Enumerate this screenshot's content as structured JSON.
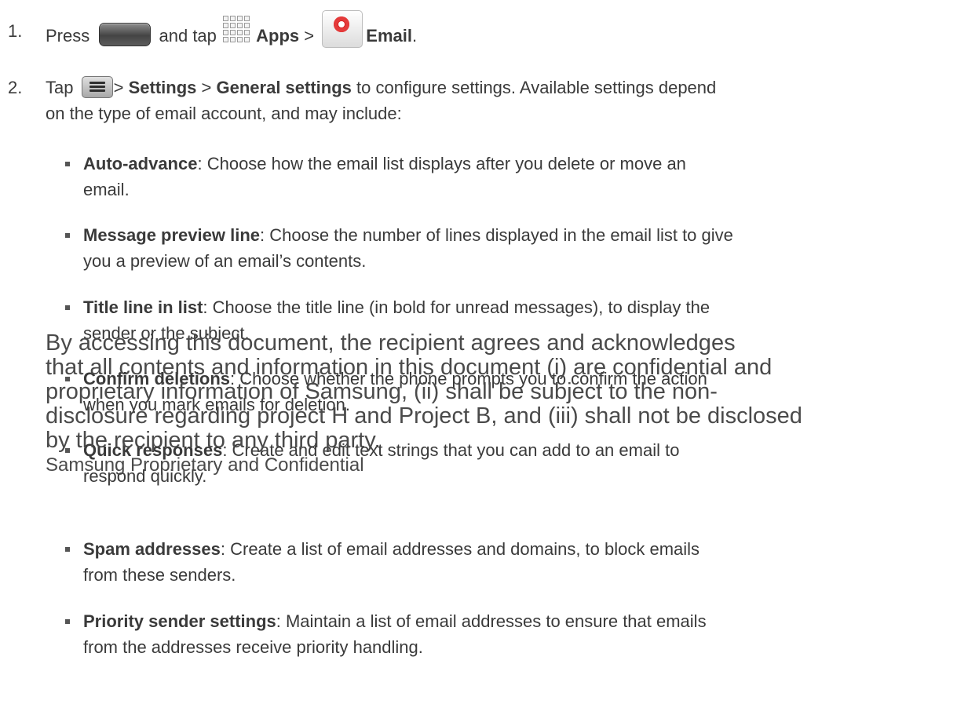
{
  "step1": {
    "number": "1.",
    "text_press": "Press",
    "text_and_tap": "and tap",
    "apps_label": "Apps",
    "separator": ">",
    "email_label": "Email",
    "end": ".",
    "icons": [
      "home-key-icon",
      "apps-grid-icon",
      "email-app-icon"
    ]
  },
  "step2": {
    "number": "2.",
    "text_tap": "Tap",
    "sep1": ">",
    "settings_label": "Settings",
    "sep2": ">",
    "general_settings_label": "General settings",
    "line1_rest": "to configure settings. Available settings depend",
    "line2": "on the type of email account, and may include:",
    "icons": [
      "menu-key-icon"
    ]
  },
  "bullets": [
    {
      "term": "Auto-advance",
      "line1": ": Choose how the email list displays after you delete or move an",
      "line2": "email."
    },
    {
      "term": "Message preview line",
      "line1": ": Choose the number of lines displayed in the email list to give",
      "line2": "you a preview of an email’s contents."
    },
    {
      "term": "Title line in list",
      "line1": ": Choose the title line (in bold for unread messages), to display the",
      "line2": "sender or the subject."
    },
    {
      "term": "Confirm deletions",
      "line1": ": Choose whether the phone prompts you to confirm the action",
      "line2": "when you mark emails for deletion."
    },
    {
      "term": "Quick responses",
      "line1": ": Create and edit text strings that you can add to an email to",
      "line2": "respond quickly."
    },
    {
      "term": "Spam addresses",
      "line1": ": Create a list of email addresses and domains, to block emails",
      "line2": "from these senders."
    },
    {
      "term": "Priority sender settings",
      "line1": ": Maintain a list of email addresses to ensure that emails",
      "line2": "from the addresses receive priority handling."
    }
  ],
  "watermark": {
    "line1": "By accessing this document, the recipient agrees and acknowledges",
    "line2": "that all contents and information in this document (i) are confidential and",
    "line3": "proprietary information of Samsung, (ii) shall be subject to the non-",
    "line4": "disclosure regarding project H and Project B, and (iii) shall not be disclosed",
    "line5": "by the recipient to any third party.",
    "footer": "Samsung Proprietary and Confidential"
  },
  "colors": {
    "text": "#3a3a3a",
    "bullet": "#555555",
    "email_icon_red": "#d61f1f"
  }
}
